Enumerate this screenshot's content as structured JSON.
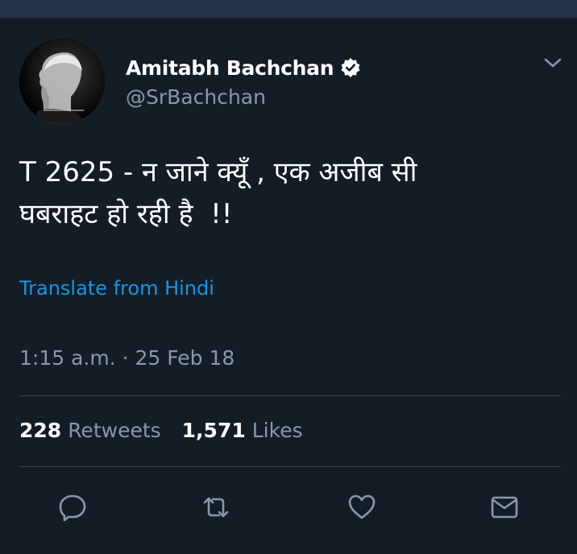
{
  "tweet": {
    "author": {
      "display_name": "Amitabh Bachchan",
      "handle": "@SrBachchan",
      "verified": true
    },
    "text": "T 2625 - न जाने क्यूँ , एक अजीब सी\nघबराहट हो रही है  !!",
    "translate_label": "Translate from Hindi",
    "timestamp": "1:15 a.m. · 25 Feb 18",
    "stats": {
      "retweets_count": "228",
      "retweets_label": "Retweets",
      "likes_count": "1,571",
      "likes_label": "Likes"
    },
    "actions": [
      {
        "name": "reply",
        "icon": "reply-icon"
      },
      {
        "name": "retweet",
        "icon": "retweet-icon"
      },
      {
        "name": "like",
        "icon": "heart-icon"
      },
      {
        "name": "direct-message",
        "icon": "envelope-icon"
      }
    ]
  },
  "colors": {
    "background": "#141d26",
    "top_bar": "#243447",
    "primary_text": "#ffffff",
    "secondary_text": "#8899a6",
    "link": "#1b95e0",
    "divider": "#38444d"
  }
}
